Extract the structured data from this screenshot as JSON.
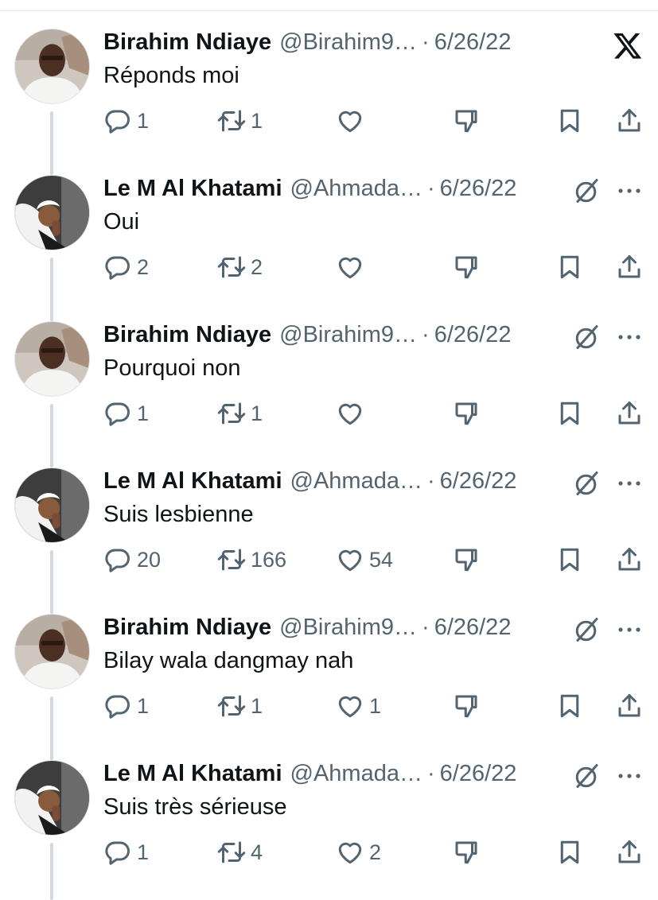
{
  "tweets": [
    {
      "author": "Birahim Ndiaye",
      "handle": "@Birahim9…",
      "separator": "·",
      "date": "6/26/22",
      "text": "Réponds moi",
      "avatar": "birahim",
      "corner_icon": "x-logo-icon",
      "replies": "1",
      "retweets": "1",
      "likes": ""
    },
    {
      "author": "Le M Al Khatami",
      "handle": "@Ahmada…",
      "separator": "·",
      "date": "6/26/22",
      "text": "Oui",
      "avatar": "khatami",
      "corner_icon": "grok-icon",
      "replies": "2",
      "retweets": "2",
      "likes": ""
    },
    {
      "author": "Birahim Ndiaye",
      "handle": "@Birahim9…",
      "separator": "·",
      "date": "6/26/22",
      "text": "Pourquoi non",
      "avatar": "birahim",
      "corner_icon": "grok-icon",
      "replies": "1",
      "retweets": "1",
      "likes": ""
    },
    {
      "author": "Le M Al Khatami",
      "handle": "@Ahmada…",
      "separator": "·",
      "date": "6/26/22",
      "text": "Suis lesbienne",
      "avatar": "khatami",
      "corner_icon": "grok-icon",
      "replies": "20",
      "retweets": "166",
      "likes": "54"
    },
    {
      "author": "Birahim Ndiaye",
      "handle": "@Birahim9…",
      "separator": "·",
      "date": "6/26/22",
      "text": "Bilay wala dangmay nah",
      "avatar": "birahim",
      "corner_icon": "grok-icon",
      "replies": "1",
      "retweets": "1",
      "likes": "1"
    },
    {
      "author": "Le M Al Khatami",
      "handle": "@Ahmada…",
      "separator": "·",
      "date": "6/26/22",
      "text": "Suis très sérieuse",
      "avatar": "khatami",
      "corner_icon": "grok-icon",
      "replies": "1",
      "retweets": "4",
      "likes": "2"
    }
  ],
  "colors": {
    "text_primary": "#0f1419",
    "text_secondary": "#536471",
    "thread_line": "#cfd9de"
  }
}
